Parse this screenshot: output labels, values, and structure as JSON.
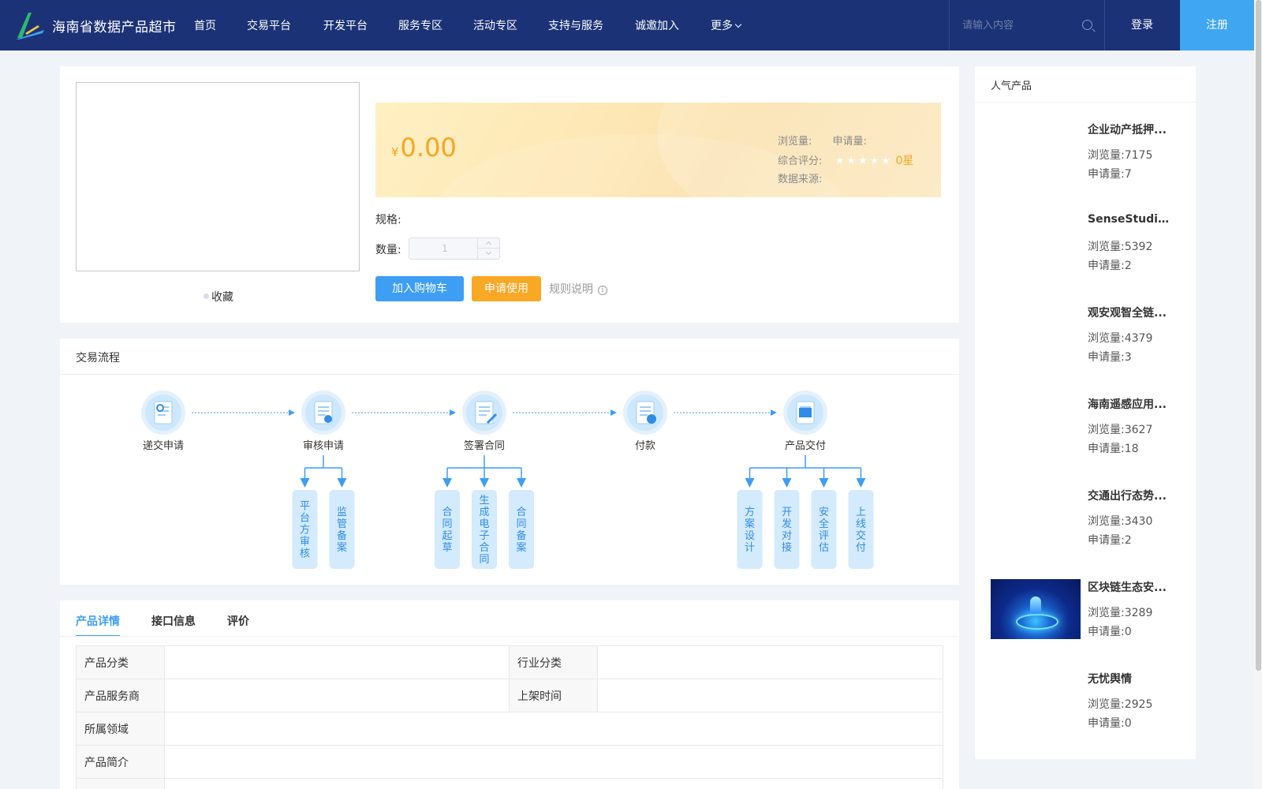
{
  "header": {
    "site_title": "海南省数据产品超市",
    "nav": [
      {
        "label": "首页"
      },
      {
        "label": "交易平台"
      },
      {
        "label": "开发平台"
      },
      {
        "label": "服务专区"
      },
      {
        "label": "活动专区"
      },
      {
        "label": "支持与服务"
      },
      {
        "label": "诚邀加入"
      },
      {
        "label": "更多"
      }
    ],
    "search_placeholder": "请输入内容",
    "login_label": "登录",
    "register_label": "注册",
    "colors": {
      "bg": "#1b3276",
      "register": "#3fa6f2"
    }
  },
  "product": {
    "favorite_label": "收藏",
    "currency": "¥",
    "price": "0.00",
    "views_label": "浏览量:",
    "applications_label": "申请量:",
    "rating_label": "综合评分:",
    "rating_value": 0,
    "rating_max": 5,
    "rating_text": "0星",
    "source_label": "数据来源:",
    "spec_label": "规格:",
    "qty_label": "数量:",
    "qty_value": "1",
    "cart_button": "加入购物车",
    "apply_button": "申请使用",
    "rules_link": "规则说明",
    "colors": {
      "price": "#f5a623",
      "cart": "#3d9ef4",
      "apply": "#f9a825"
    }
  },
  "flow": {
    "title": "交易流程",
    "steps": [
      {
        "label": "递交申请",
        "icon": "application-form-icon",
        "substeps": []
      },
      {
        "label": "审核申请",
        "icon": "review-icon",
        "substeps": [
          "平台方审核",
          "监管备案"
        ]
      },
      {
        "label": "签署合同",
        "icon": "contract-sign-icon",
        "substeps": [
          "合同起草",
          "生成电子合同",
          "合同备案"
        ]
      },
      {
        "label": "付款",
        "icon": "payment-wallet-icon",
        "substeps": []
      },
      {
        "label": "产品交付",
        "icon": "delivery-list-icon",
        "substeps": [
          "方案设计",
          "开发对接",
          "安全评估",
          "上线交付"
        ]
      }
    ]
  },
  "detail": {
    "tabs": [
      {
        "label": "产品详情"
      },
      {
        "label": "接口信息"
      },
      {
        "label": "评价"
      }
    ],
    "rows": [
      {
        "label1": "产品分类",
        "value1": "",
        "label2": "行业分类",
        "value2": ""
      },
      {
        "label1": "产品服务商",
        "value1": "",
        "label2": "上架时间",
        "value2": ""
      },
      {
        "label1": "所属领域",
        "value1": ""
      },
      {
        "label1": "产品简介",
        "value1": ""
      }
    ]
  },
  "popular": {
    "title": "人气产品",
    "items": [
      {
        "name": "企业动产抵押...",
        "views": "浏览量:7175",
        "apps": "申请量:7",
        "has_image": false
      },
      {
        "name": "SenseStudio...",
        "views": "浏览量:5392",
        "apps": "申请量:2",
        "has_image": false
      },
      {
        "name": "观安观智全链...",
        "views": "浏览量:4379",
        "apps": "申请量:3",
        "has_image": false
      },
      {
        "name": "海南遥感应用...",
        "views": "浏览量:3627",
        "apps": "申请量:18",
        "has_image": false
      },
      {
        "name": "交通出行态势...",
        "views": "浏览量:3430",
        "apps": "申请量:2",
        "has_image": false
      },
      {
        "name": "区块链生态安...",
        "views": "浏览量:3289",
        "apps": "申请量:0",
        "has_image": true
      },
      {
        "name": "无忧舆情",
        "views": "浏览量:2925",
        "apps": "申请量:0",
        "has_image": false
      }
    ]
  }
}
